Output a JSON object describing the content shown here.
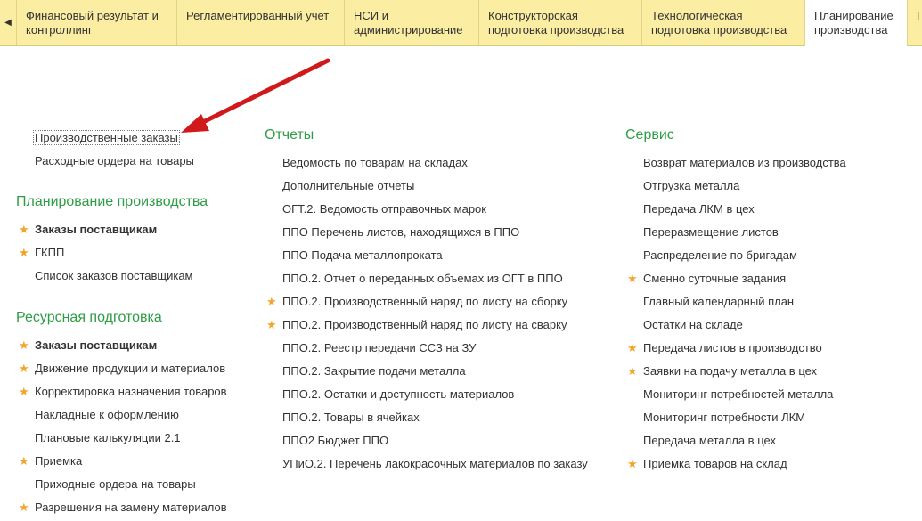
{
  "tabs": [
    {
      "line1": "Финансовый результат и",
      "line2": "контроллинг"
    },
    {
      "line1": "Регламентированный учет",
      "line2": ""
    },
    {
      "line1": "НСИ и",
      "line2": "администрирование"
    },
    {
      "line1": "Конструкторская",
      "line2": "подготовка производства"
    },
    {
      "line1": "Технологическая",
      "line2": "подготовка производства"
    },
    {
      "line1": "Планирование",
      "line2": "производства"
    },
    {
      "line1": "П",
      "line2": ""
    }
  ],
  "left_column": {
    "top_items": [
      {
        "label": "Производственные заказы",
        "starred": false,
        "bold": false
      },
      {
        "label": "Расходные ордера на товары",
        "starred": false,
        "bold": false
      }
    ],
    "groups": [
      {
        "title": "Планирование производства",
        "items": [
          {
            "label": "Заказы поставщикам",
            "starred": true,
            "bold": true
          },
          {
            "label": "ГКПП",
            "starred": true,
            "bold": false
          },
          {
            "label": "Список заказов поставщикам",
            "starred": false,
            "bold": false
          }
        ]
      },
      {
        "title": "Ресурсная подготовка",
        "items": [
          {
            "label": "Заказы поставщикам",
            "starred": true,
            "bold": true
          },
          {
            "label": "Движение продукции и материалов",
            "starred": true,
            "bold": false
          },
          {
            "label": "Корректировка назначения товаров",
            "starred": true,
            "bold": false
          },
          {
            "label": "Накладные к оформлению",
            "starred": false,
            "bold": false
          },
          {
            "label": "Плановые калькуляции 2.1",
            "starred": false,
            "bold": false
          },
          {
            "label": "Приемка",
            "starred": true,
            "bold": false
          },
          {
            "label": "Приходные ордера на товары",
            "starred": false,
            "bold": false
          },
          {
            "label": "Разрешения на замену материалов",
            "starred": true,
            "bold": false
          }
        ]
      }
    ]
  },
  "reports_column": {
    "title": "Отчеты",
    "items": [
      {
        "label": "Ведомость по товарам на складах",
        "starred": false
      },
      {
        "label": "Дополнительные отчеты",
        "starred": false
      },
      {
        "label": "ОГТ.2. Ведомость отправочных марок",
        "starred": false
      },
      {
        "label": "ППО Перечень листов, находящихся в ППО",
        "starred": false
      },
      {
        "label": "ППО Подача металлопроката",
        "starred": false
      },
      {
        "label": "ППО.2. Отчет о переданных объемах из ОГТ в ППО",
        "starred": false
      },
      {
        "label": "ППО.2. Производственный наряд по листу на сборку",
        "starred": true
      },
      {
        "label": "ППО.2. Производственный наряд по листу на сварку",
        "starred": true
      },
      {
        "label": "ППО.2. Реестр передачи ССЗ на ЗУ",
        "starred": false
      },
      {
        "label": "ППО.2. Закрытие подачи металла",
        "starred": false
      },
      {
        "label": "ППО.2. Остатки и доступность материалов",
        "starred": false
      },
      {
        "label": "ППО.2. Товары в ячейках",
        "starred": false
      },
      {
        "label": "ППО2 Бюджет ППО",
        "starred": false
      },
      {
        "label": "УПиО.2. Перечень лакокрасочных материалов по заказу",
        "starred": false
      }
    ]
  },
  "service_column": {
    "title": "Сервис",
    "items": [
      {
        "label": "Возврат материалов из производства",
        "starred": false
      },
      {
        "label": "Отгрузка металла",
        "starred": false
      },
      {
        "label": "Передача ЛКМ в цех",
        "starred": false
      },
      {
        "label": "Переразмещение листов",
        "starred": false
      },
      {
        "label": "Распределение по бригадам",
        "starred": false
      },
      {
        "label": "Сменно суточные задания",
        "starred": true
      },
      {
        "label": "Главный календарный план",
        "starred": false
      },
      {
        "label": "Остатки на складе",
        "starred": false
      },
      {
        "label": "Передача листов в производство",
        "starred": true
      },
      {
        "label": "Заявки на подачу металла в цех",
        "starred": true
      },
      {
        "label": "Мониторинг потребностей металла",
        "starred": false
      },
      {
        "label": "Мониторинг потребности ЛКМ",
        "starred": false
      },
      {
        "label": "Передача металла в цех",
        "starred": false
      },
      {
        "label": "Приемка товаров на склад",
        "starred": true
      }
    ]
  },
  "colors": {
    "topbar": "#fbeda2",
    "group_title": "#2e9d46",
    "star": "#f2a52a",
    "annotation_arrow": "#d0191b"
  },
  "icons": {
    "scroll_left": "triangle-left-icon",
    "star": "star-icon",
    "annotation": "red-arrow-icon"
  }
}
